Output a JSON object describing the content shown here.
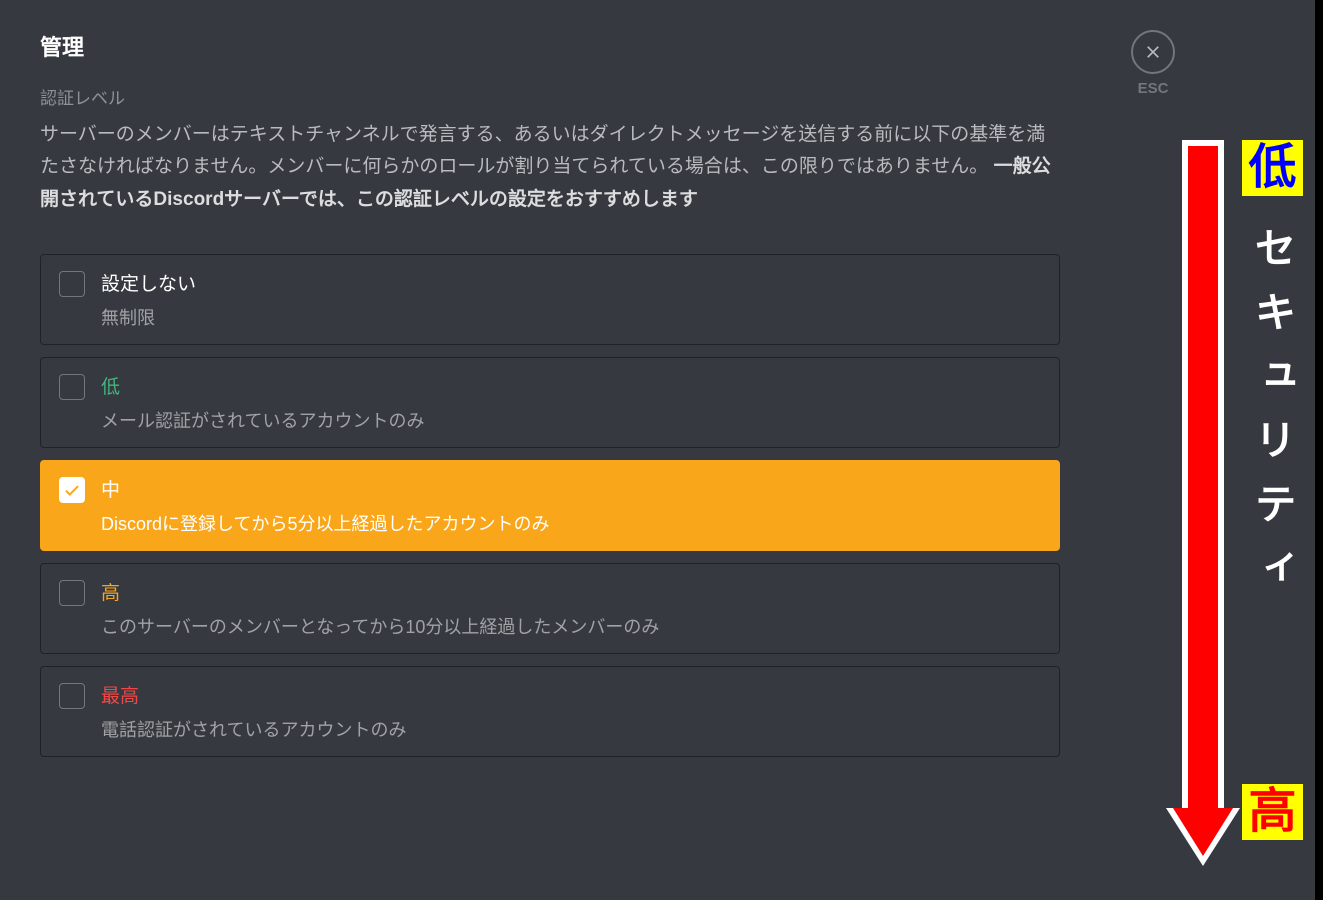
{
  "header": "管理",
  "sectionTitle": "認証レベル",
  "descriptionPart1": "サーバーのメンバーはテキストチャンネルで発言する、あるいはダイレクトメッセージを送信する前に以下の基準を満たさなければなりません。メンバーに何らかのロールが割り当てられている場合は、この限りではありません。 ",
  "descriptionBold": "一般公開されているDiscordサーバーでは、この認証レベルの設定をおすすめします",
  "closeLabel": "ESC",
  "options": {
    "none": {
      "title": "設定しない",
      "desc": "無制限"
    },
    "low": {
      "title": "低",
      "desc": "メール認証がされているアカウントのみ"
    },
    "medium": {
      "title": "中",
      "desc": "Discordに登録してから5分以上経過したアカウントのみ"
    },
    "high": {
      "title": "高",
      "desc": "このサーバーのメンバーとなってから10分以上経過したメンバーのみ"
    },
    "highest": {
      "title": "最高",
      "desc": "電話認証がされているアカウントのみ"
    }
  },
  "annotation": {
    "badgeLow": "低",
    "vertical": "セキュリティ",
    "badgeHigh": "高"
  }
}
